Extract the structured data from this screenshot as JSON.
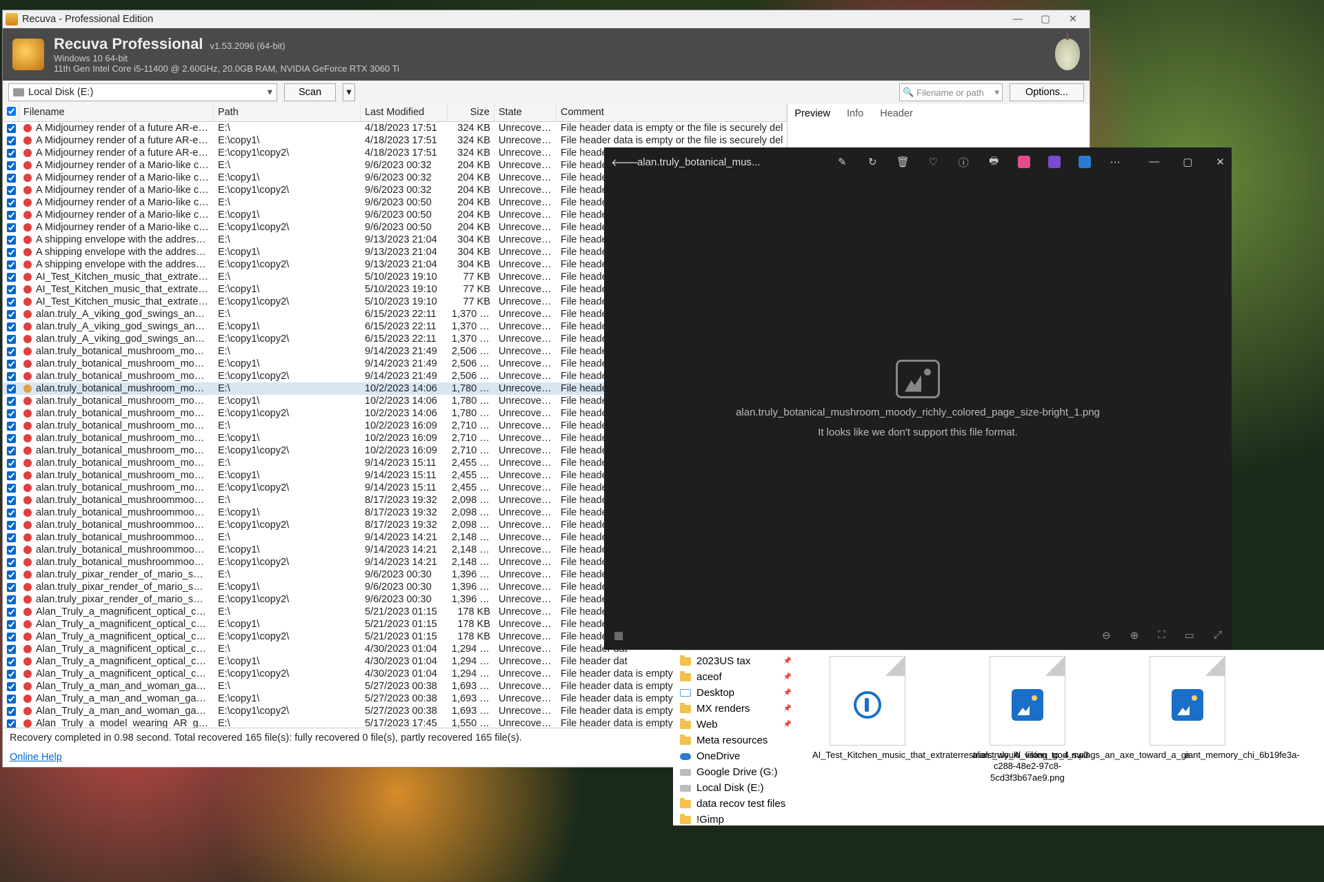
{
  "recuva": {
    "title": "Recuva - Professional Edition",
    "product": "Recuva Professional",
    "version": "v1.53.2096 (64-bit)",
    "os_line": "Windows 10 64-bit",
    "hw_line": "11th Gen Intel Core i5-11400 @ 2.60GHz, 20.0GB RAM, NVIDIA GeForce RTX 3060 Ti",
    "drive": "Local Disk (E:)",
    "scan_label": "Scan",
    "search_placeholder": "Filename or path",
    "options_label": "Options...",
    "columns": {
      "chk": "",
      "name": "Filename",
      "path": "Path",
      "mod": "Last Modified",
      "size": "Size",
      "state": "State",
      "comment": "Comment"
    },
    "right_tabs": {
      "preview": "Preview",
      "info": "Info",
      "header": "Header"
    },
    "status": "Recovery completed in 0.98 second. Total recovered 165 file(s): fully recovered 0 file(s), partly recovered 165 file(s).",
    "help": "Online Help",
    "rows": [
      {
        "name": "A Midjourney render of a future AR-enhanced hou...",
        "path": "E:\\",
        "mod": "4/18/2023 17:51",
        "size": "324 KB",
        "state": "Unrecoverable",
        "comment": "File header data is empty or the file is securely del",
        "dot": "red"
      },
      {
        "name": "A Midjourney render of a future AR-enhanced hou...",
        "path": "E:\\copy1\\",
        "mod": "4/18/2023 17:51",
        "size": "324 KB",
        "state": "Unrecoverable",
        "comment": "File header data is empty or the file is securely del",
        "dot": "red"
      },
      {
        "name": "A Midjourney render of a future AR-enhanced hou...",
        "path": "E:\\copy1\\copy2\\",
        "mod": "4/18/2023 17:51",
        "size": "324 KB",
        "state": "Unrecoverable",
        "comment": "File header dat",
        "dot": "red"
      },
      {
        "name": "A Midjourney render of a Mario-like character wear...",
        "path": "E:\\",
        "mod": "9/6/2023 00:32",
        "size": "204 KB",
        "state": "Unrecoverable",
        "comment": "File header dat",
        "dot": "red"
      },
      {
        "name": "A Midjourney render of a Mario-like character wear...",
        "path": "E:\\copy1\\",
        "mod": "9/6/2023 00:32",
        "size": "204 KB",
        "state": "Unrecoverable",
        "comment": "File header dat",
        "dot": "red"
      },
      {
        "name": "A Midjourney render of a Mario-like character wear...",
        "path": "E:\\copy1\\copy2\\",
        "mod": "9/6/2023 00:32",
        "size": "204 KB",
        "state": "Unrecoverable",
        "comment": "File header dat",
        "dot": "red"
      },
      {
        "name": "A Midjourney render of a Mario-like character with ...",
        "path": "E:\\",
        "mod": "9/6/2023 00:50",
        "size": "204 KB",
        "state": "Unrecoverable",
        "comment": "File header dat",
        "dot": "red"
      },
      {
        "name": "A Midjourney render of a Mario-like character with ...",
        "path": "E:\\copy1\\",
        "mod": "9/6/2023 00:50",
        "size": "204 KB",
        "state": "Unrecoverable",
        "comment": "File header dat",
        "dot": "red"
      },
      {
        "name": "A Midjourney render of a Mario-like character with ...",
        "path": "E:\\copy1\\copy2\\",
        "mod": "9/6/2023 00:50",
        "size": "204 KB",
        "state": "Unrecoverable",
        "comment": "File header dat",
        "dot": "red"
      },
      {
        "name": "A shipping envelope with the address of the White ...",
        "path": "E:\\",
        "mod": "9/13/2023 21:04",
        "size": "304 KB",
        "state": "Unrecoverable",
        "comment": "File header dat",
        "dot": "red"
      },
      {
        "name": "A shipping envelope with the address of the White ...",
        "path": "E:\\copy1\\",
        "mod": "9/13/2023 21:04",
        "size": "304 KB",
        "state": "Unrecoverable",
        "comment": "File header dat",
        "dot": "red"
      },
      {
        "name": "A shipping envelope with the address of the White ...",
        "path": "E:\\copy1\\copy2\\",
        "mod": "9/13/2023 21:04",
        "size": "304 KB",
        "state": "Unrecoverable",
        "comment": "File header dat",
        "dot": "red"
      },
      {
        "name": "AI_Test_Kitchen_music_that_extraterrestrials_would...",
        "path": "E:\\",
        "mod": "5/10/2023 19:10",
        "size": "77 KB",
        "state": "Unrecoverable",
        "comment": "File header dat",
        "dot": "red"
      },
      {
        "name": "AI_Test_Kitchen_music_that_extraterrestrials_would...",
        "path": "E:\\copy1\\",
        "mod": "5/10/2023 19:10",
        "size": "77 KB",
        "state": "Unrecoverable",
        "comment": "File header dat",
        "dot": "red"
      },
      {
        "name": "AI_Test_Kitchen_music_that_extraterrestrials_would...",
        "path": "E:\\copy1\\copy2\\",
        "mod": "5/10/2023 19:10",
        "size": "77 KB",
        "state": "Unrecoverable",
        "comment": "File header dat",
        "dot": "red"
      },
      {
        "name": "alan.truly_A_viking_god_swings_an_axe_toward_a_...",
        "path": "E:\\",
        "mod": "6/15/2023 22:11",
        "size": "1,370 KB",
        "state": "Unrecoverable",
        "comment": "File header dat",
        "dot": "red"
      },
      {
        "name": "alan.truly_A_viking_god_swings_an_axe_toward_a_...",
        "path": "E:\\copy1\\",
        "mod": "6/15/2023 22:11",
        "size": "1,370 KB",
        "state": "Unrecoverable",
        "comment": "File header dat",
        "dot": "red"
      },
      {
        "name": "alan.truly_A_viking_god_swings_an_axe_toward_a_...",
        "path": "E:\\copy1\\copy2\\",
        "mod": "6/15/2023 22:11",
        "size": "1,370 KB",
        "state": "Unrecoverable",
        "comment": "File header dat",
        "dot": "red"
      },
      {
        "name": "alan.truly_botanical_mushroom_moody_richly_col...",
        "path": "E:\\",
        "mod": "9/14/2023 21:49",
        "size": "2,506 KB",
        "state": "Unrecoverable",
        "comment": "File header dat",
        "dot": "red"
      },
      {
        "name": "alan.truly_botanical_mushroom_moody_richly_col...",
        "path": "E:\\copy1\\",
        "mod": "9/14/2023 21:49",
        "size": "2,506 KB",
        "state": "Unrecoverable",
        "comment": "File header dat",
        "dot": "red"
      },
      {
        "name": "alan.truly_botanical_mushroom_moody_richly_col...",
        "path": "E:\\copy1\\copy2\\",
        "mod": "9/14/2023 21:49",
        "size": "2,506 KB",
        "state": "Unrecoverable",
        "comment": "File header dat",
        "dot": "red"
      },
      {
        "name": "alan.truly_botanical_mushroom_moody_richly_col...",
        "path": "E:\\",
        "mod": "10/2/2023 14:06",
        "size": "1,780 KB",
        "state": "Unrecoverable",
        "comment": "File header dat",
        "dot": "orange",
        "selected": true
      },
      {
        "name": "alan.truly_botanical_mushroom_moody_richly_col...",
        "path": "E:\\copy1\\",
        "mod": "10/2/2023 14:06",
        "size": "1,780 KB",
        "state": "Unrecoverable",
        "comment": "File header dat",
        "dot": "red"
      },
      {
        "name": "alan.truly_botanical_mushroom_moody_richly_col...",
        "path": "E:\\copy1\\copy2\\",
        "mod": "10/2/2023 14:06",
        "size": "1,780 KB",
        "state": "Unrecoverable",
        "comment": "File header dat",
        "dot": "red"
      },
      {
        "name": "alan.truly_botanical_mushroom_moody_richly_col...",
        "path": "E:\\",
        "mod": "10/2/2023 16:09",
        "size": "2,710 KB",
        "state": "Unrecoverable",
        "comment": "File header dat",
        "dot": "red"
      },
      {
        "name": "alan.truly_botanical_mushroom_moody_richly_col...",
        "path": "E:\\copy1\\",
        "mod": "10/2/2023 16:09",
        "size": "2,710 KB",
        "state": "Unrecoverable",
        "comment": "File header dat",
        "dot": "red"
      },
      {
        "name": "alan.truly_botanical_mushroom_moody_richly_col...",
        "path": "E:\\copy1\\copy2\\",
        "mod": "10/2/2023 16:09",
        "size": "2,710 KB",
        "state": "Unrecoverable",
        "comment": "File header dat",
        "dot": "red"
      },
      {
        "name": "alan.truly_botanical_mushroom_moody_richly_col...",
        "path": "E:\\",
        "mod": "9/14/2023 15:11",
        "size": "2,455 KB",
        "state": "Unrecoverable",
        "comment": "File header dat",
        "dot": "red"
      },
      {
        "name": "alan.truly_botanical_mushroom_moody_richly_col...",
        "path": "E:\\copy1\\",
        "mod": "9/14/2023 15:11",
        "size": "2,455 KB",
        "state": "Unrecoverable",
        "comment": "File header dat",
        "dot": "red"
      },
      {
        "name": "alan.truly_botanical_mushroom_moody_richly_col...",
        "path": "E:\\copy1\\copy2\\",
        "mod": "9/14/2023 15:11",
        "size": "2,455 KB",
        "state": "Unrecoverable",
        "comment": "File header dat",
        "dot": "red"
      },
      {
        "name": "alan.truly_botanical_mushroommoodyrichly_color...",
        "path": "E:\\",
        "mod": "8/17/2023 19:32",
        "size": "2,098 KB",
        "state": "Unrecoverable",
        "comment": "File header dat",
        "dot": "red"
      },
      {
        "name": "alan.truly_botanical_mushroommoodyrichly_color...",
        "path": "E:\\copy1\\",
        "mod": "8/17/2023 19:32",
        "size": "2,098 KB",
        "state": "Unrecoverable",
        "comment": "File header dat",
        "dot": "red"
      },
      {
        "name": "alan.truly_botanical_mushroommoodyrichly_color...",
        "path": "E:\\copy1\\copy2\\",
        "mod": "8/17/2023 19:32",
        "size": "2,098 KB",
        "state": "Unrecoverable",
        "comment": "File header dat",
        "dot": "red"
      },
      {
        "name": "alan.truly_botanical_mushroommoodyrichly_color...",
        "path": "E:\\",
        "mod": "9/14/2023 14:21",
        "size": "2,148 KB",
        "state": "Unrecoverable",
        "comment": "File header dat",
        "dot": "red"
      },
      {
        "name": "alan.truly_botanical_mushroommoodyrichly_color...",
        "path": "E:\\copy1\\",
        "mod": "9/14/2023 14:21",
        "size": "2,148 KB",
        "state": "Unrecoverable",
        "comment": "File header dat",
        "dot": "red"
      },
      {
        "name": "alan.truly_botanical_mushroommoodyrichly_color...",
        "path": "E:\\copy1\\copy2\\",
        "mod": "9/14/2023 14:21",
        "size": "2,148 KB",
        "state": "Unrecoverable",
        "comment": "File header dat",
        "dot": "red"
      },
      {
        "name": "alan.truly_pixar_render_of_mario_smiling_eyes_cov...",
        "path": "E:\\",
        "mod": "9/6/2023 00:30",
        "size": "1,396 KB",
        "state": "Unrecoverable",
        "comment": "File header dat",
        "dot": "red"
      },
      {
        "name": "alan.truly_pixar_render_of_mario_smiling_eyes_cov...",
        "path": "E:\\copy1\\",
        "mod": "9/6/2023 00:30",
        "size": "1,396 KB",
        "state": "Unrecoverable",
        "comment": "File header dat",
        "dot": "red"
      },
      {
        "name": "alan.truly_pixar_render_of_mario_smiling_eyes_cov...",
        "path": "E:\\copy1\\copy2\\",
        "mod": "9/6/2023 00:30",
        "size": "1,396 KB",
        "state": "Unrecoverable",
        "comment": "File header dat",
        "dot": "red"
      },
      {
        "name": "Alan_Truly_a_magnificent_optical_computer_radiat...",
        "path": "E:\\",
        "mod": "5/21/2023 01:15",
        "size": "178 KB",
        "state": "Unrecoverable",
        "comment": "File header dat",
        "dot": "red"
      },
      {
        "name": "Alan_Truly_a_magnificent_optical_computer_radiat...",
        "path": "E:\\copy1\\",
        "mod": "5/21/2023 01:15",
        "size": "178 KB",
        "state": "Unrecoverable",
        "comment": "File header dat",
        "dot": "red"
      },
      {
        "name": "Alan_Truly_a_magnificent_optical_computer_radiat...",
        "path": "E:\\copy1\\copy2\\",
        "mod": "5/21/2023 01:15",
        "size": "178 KB",
        "state": "Unrecoverable",
        "comment": "File header dat",
        "dot": "red"
      },
      {
        "name": "Alan_Truly_a_magnificent_optical_computer_radiat...",
        "path": "E:\\",
        "mod": "4/30/2023 01:04",
        "size": "1,294 KB",
        "state": "Unrecoverable",
        "comment": "File header dat",
        "dot": "red"
      },
      {
        "name": "Alan_Truly_a_magnificent_optical_computer_radiat...",
        "path": "E:\\copy1\\",
        "mod": "4/30/2023 01:04",
        "size": "1,294 KB",
        "state": "Unrecoverable",
        "comment": "File header dat",
        "dot": "red"
      },
      {
        "name": "Alan_Truly_a_magnificent_optical_computer_radiat...",
        "path": "E:\\copy1\\copy2\\",
        "mod": "4/30/2023 01:04",
        "size": "1,294 KB",
        "state": "Unrecoverable",
        "comment": "File header data is empty or the file",
        "dot": "red"
      },
      {
        "name": "Alan_Truly_a_man_and_woman_gaze_with_wonder...",
        "path": "E:\\",
        "mod": "5/27/2023 00:38",
        "size": "1,693 KB",
        "state": "Unrecoverable",
        "comment": "File header data is empty or the file",
        "dot": "red"
      },
      {
        "name": "Alan_Truly_a_man_and_woman_gaze_with_wonder...",
        "path": "E:\\copy1\\",
        "mod": "5/27/2023 00:38",
        "size": "1,693 KB",
        "state": "Unrecoverable",
        "comment": "File header data is empty or the file",
        "dot": "red"
      },
      {
        "name": "Alan_Truly_a_man_and_woman_gaze_with_wonder...",
        "path": "E:\\copy1\\copy2\\",
        "mod": "5/27/2023 00:38",
        "size": "1,693 KB",
        "state": "Unrecoverable",
        "comment": "File header data is empty or the file",
        "dot": "red"
      },
      {
        "name": "Alan_Truly_a_model_wearing_AR_glasses_one_hand...",
        "path": "E:\\",
        "mod": "5/17/2023 17:45",
        "size": "1,550 KB",
        "state": "Unrecoverable",
        "comment": "File header data is empty or the file",
        "dot": "red"
      }
    ]
  },
  "photos": {
    "title_short": "alan.truly_botanical_mus...",
    "filename": "alan.truly_botanical_mushroom_moody_richly_colored_page_size-bright_1.png",
    "unsupported": "It looks like we don't support this file format."
  },
  "explorer": {
    "nav": [
      "2023US  tax",
      "aceof",
      "Desktop",
      "MX renders",
      "Web",
      "Meta resources",
      "OneDrive",
      "Google Drive (G:)",
      "Local Disk (E:)",
      "data recov test files",
      "!Gimp"
    ],
    "thumbs": [
      {
        "label": "AI_Test_Kitchen_music_that_extraterrestrials_would_listen_to_4.mp3",
        "kind": "audio"
      },
      {
        "label": "alan.truly_A_viking_god_swings_an_axe_toward_a_giant_memory_chi_6b19fe3a-c288-48e2-97c8-5cd3f3b67ae9.png",
        "kind": "image"
      },
      {
        "label": "a",
        "kind": "image"
      }
    ]
  }
}
